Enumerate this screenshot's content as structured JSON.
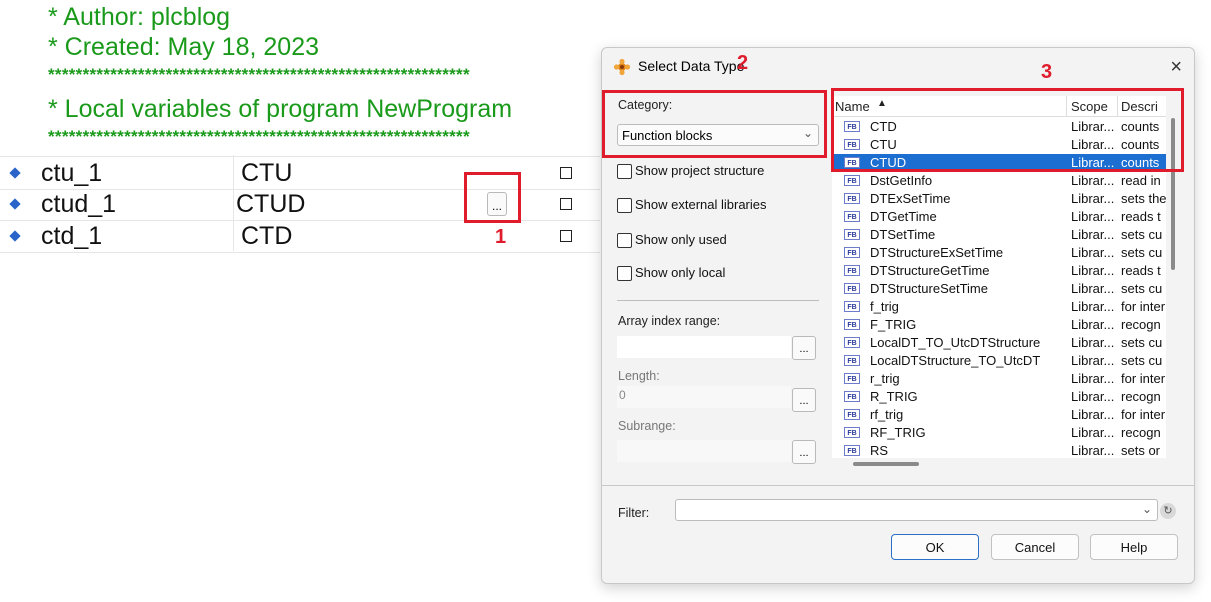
{
  "editor": {
    "comment_author": "* Author: plcblog",
    "comment_created": "* Created: May 18, 2023",
    "stars": "*************************************************************",
    "comment_local": "* Local variables of program NewProgram",
    "variables": [
      {
        "name": "ctu_1",
        "type": "CTU"
      },
      {
        "name": "ctud_1",
        "type": "CTUD"
      },
      {
        "name": "ctd_1",
        "type": "CTD"
      }
    ],
    "ellipsis_label": "..."
  },
  "annotations": {
    "label1": "1",
    "label2": "2",
    "label3": "3",
    "color": "#e01c2c"
  },
  "dialog": {
    "title": "Select Data Type",
    "close_icon": "×",
    "category_label": "Category:",
    "category_value": "Function blocks",
    "checkboxes": [
      "Show project structure",
      "Show external libraries",
      "Show only used",
      "Show only local"
    ],
    "array_index_label": "Array index range:",
    "length_label": "Length:",
    "length_value": "0",
    "subrange_label": "Subrange:",
    "small_btn_label": "...",
    "columns": {
      "name": "Name",
      "scope": "Scope",
      "desc": "Descri"
    },
    "rows": [
      {
        "name": "CTD",
        "scope": "Librar...",
        "desc": "counts"
      },
      {
        "name": "CTU",
        "scope": "Librar...",
        "desc": "counts"
      },
      {
        "name": "CTUD",
        "scope": "Librar...",
        "desc": "counts",
        "selected": true
      },
      {
        "name": "DstGetInfo",
        "scope": "Librar...",
        "desc": "read in"
      },
      {
        "name": "DTExSetTime",
        "scope": "Librar...",
        "desc": "sets the"
      },
      {
        "name": "DTGetTime",
        "scope": "Librar...",
        "desc": "reads t"
      },
      {
        "name": "DTSetTime",
        "scope": "Librar...",
        "desc": "sets cu"
      },
      {
        "name": "DTStructureExSetTime",
        "scope": "Librar...",
        "desc": "sets cu"
      },
      {
        "name": "DTStructureGetTime",
        "scope": "Librar...",
        "desc": "reads t"
      },
      {
        "name": "DTStructureSetTime",
        "scope": "Librar...",
        "desc": "sets cu"
      },
      {
        "name": "f_trig",
        "scope": "Librar...",
        "desc": "for inter"
      },
      {
        "name": "F_TRIG",
        "scope": "Librar...",
        "desc": "recogn"
      },
      {
        "name": "LocalDT_TO_UtcDTStructure",
        "scope": "Librar...",
        "desc": "sets cu"
      },
      {
        "name": "LocalDTStructure_TO_UtcDT",
        "scope": "Librar...",
        "desc": "sets cu"
      },
      {
        "name": "r_trig",
        "scope": "Librar...",
        "desc": "for inter"
      },
      {
        "name": "R_TRIG",
        "scope": "Librar...",
        "desc": "recogn"
      },
      {
        "name": "rf_trig",
        "scope": "Librar...",
        "desc": "for inter"
      },
      {
        "name": "RF_TRIG",
        "scope": "Librar...",
        "desc": "recogn"
      },
      {
        "name": "RS",
        "scope": "Librar...",
        "desc": "sets or"
      }
    ],
    "fb_icon_text": "FB",
    "filter_label": "Filter:",
    "ok_label": "OK",
    "cancel_label": "Cancel",
    "help_label": "Help"
  }
}
